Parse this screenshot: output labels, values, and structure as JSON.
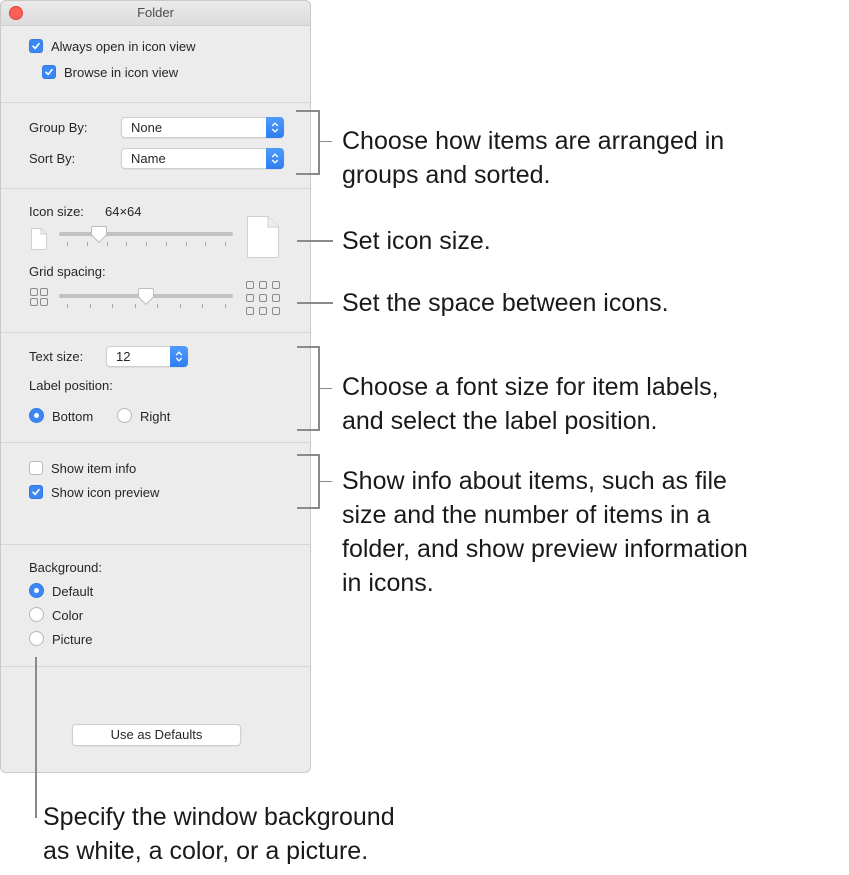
{
  "window": {
    "title": "Folder",
    "close_icon": "close-red-dot"
  },
  "view_options": {
    "always_open_icon_view": {
      "label": "Always open in icon view",
      "checked": true
    },
    "browse_icon_view": {
      "label": "Browse in icon view",
      "checked": true
    }
  },
  "arrange": {
    "group_by": {
      "label": "Group By:",
      "value": "None"
    },
    "sort_by": {
      "label": "Sort By:",
      "value": "Name"
    }
  },
  "icons": {
    "icon_size_label": "Icon size:",
    "icon_size_value": "64×64",
    "icon_size_slider_fraction": 0.2,
    "grid_spacing_label": "Grid spacing:",
    "grid_spacing_slider_fraction": 0.5,
    "small_icon": "document-small-icon",
    "large_icon": "document-large-icon",
    "grid_small_icon": "grid-2x2-icon",
    "grid_large_icon": "grid-3x3-icon"
  },
  "text": {
    "text_size_label": "Text size:",
    "text_size_value": "12",
    "label_position_label": "Label position:",
    "positions": [
      {
        "label": "Bottom",
        "selected": true
      },
      {
        "label": "Right",
        "selected": false
      }
    ]
  },
  "info": {
    "show_item_info": {
      "label": "Show item info",
      "checked": false
    },
    "show_icon_preview": {
      "label": "Show icon preview",
      "checked": true
    }
  },
  "background": {
    "label": "Background:",
    "options": [
      {
        "label": "Default",
        "selected": true
      },
      {
        "label": "Color",
        "selected": false
      },
      {
        "label": "Picture",
        "selected": false
      }
    ]
  },
  "use_as_defaults_label": "Use as Defaults",
  "callouts": {
    "arrange": [
      "Choose how items are arranged in",
      "groups and sorted."
    ],
    "icon_size": [
      "Set icon size."
    ],
    "grid_spacing": [
      "Set the space between icons."
    ],
    "text": [
      "Choose a font size for item labels,",
      "and select the label position."
    ],
    "info": [
      "Show info about items, such as file",
      "size and the number of items in a",
      "folder, and show preview information",
      "in icons."
    ],
    "background": [
      "Specify the window background",
      "as white, a color, or a picture."
    ]
  },
  "colors": {
    "accent": "#3b88f5",
    "close": "#fc5f57",
    "window_bg": "#ececec",
    "callout_line": "#8a8a8a"
  }
}
